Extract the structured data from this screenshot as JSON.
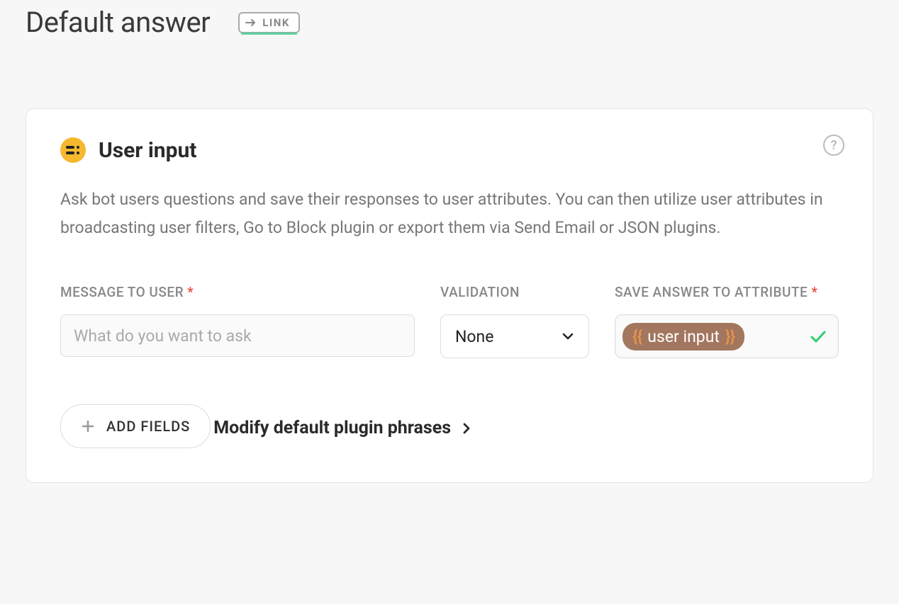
{
  "header": {
    "title": "Default answer",
    "link_label": "LINK"
  },
  "card": {
    "title": "User input",
    "description": "Ask bot users questions and save their responses to user attributes. You can then utilize user attributes in broadcasting user filters, Go to Block plugin or export them via Send Email or JSON plugins.",
    "help_tooltip": "?"
  },
  "fields": {
    "message": {
      "label": "MESSAGE TO USER",
      "required_marker": "*",
      "placeholder": "What do you want to ask"
    },
    "validation": {
      "label": "VALIDATION",
      "selected": "None"
    },
    "save_attr": {
      "label": "SAVE ANSWER TO ATTRIBUTE",
      "required_marker": "*",
      "brace_open": "{{",
      "value": "user input",
      "brace_close": "}}"
    }
  },
  "add_fields_label": "ADD FIELDS",
  "modify_phrases_label": "Modify default plugin phrases"
}
